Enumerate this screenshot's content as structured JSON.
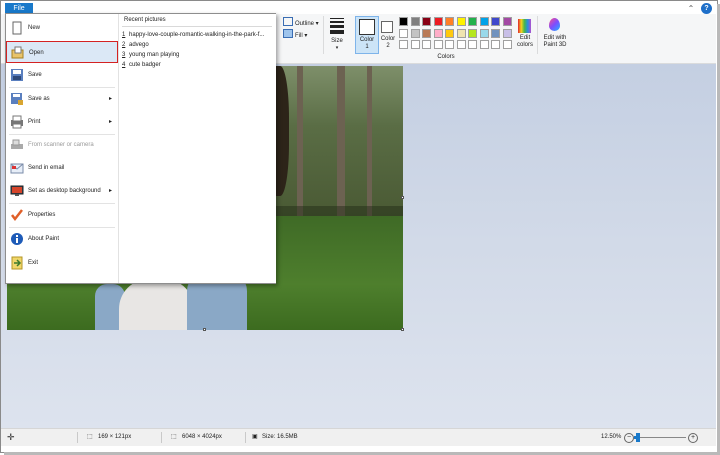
{
  "file_tab": "File",
  "ribbon": {
    "outline_label": "Outline",
    "fill_label": "Fill",
    "size_label": "Size",
    "color1_label": "Color",
    "color1_num": "1",
    "color2_label": "Color",
    "color2_num": "2",
    "colors_group_label": "Colors",
    "edit_colors_l1": "Edit",
    "edit_colors_l2": "colors",
    "paint3d_l1": "Edit with",
    "paint3d_l2": "Paint 3D",
    "palette_row1": [
      "#000000",
      "#7f7f7f",
      "#880015",
      "#ed1c24",
      "#ff7f27",
      "#fff200",
      "#22b14c",
      "#00a2e8",
      "#3f48cc",
      "#a349a4"
    ],
    "palette_row2": [
      "#ffffff",
      "#c3c3c3",
      "#b97a57",
      "#ffaec9",
      "#ffc90e",
      "#efe4b0",
      "#b5e61d",
      "#99d9ea",
      "#7092be",
      "#c8bfe7"
    ]
  },
  "menu": {
    "items": [
      {
        "label": "New",
        "icon": "new-file-icon"
      },
      {
        "label": "Open",
        "icon": "open-folder-icon",
        "selected": true
      },
      {
        "label": "Save",
        "icon": "save-icon"
      },
      {
        "label": "Save as",
        "icon": "save-as-icon",
        "submenu": true
      },
      {
        "label": "Print",
        "icon": "printer-icon",
        "submenu": true
      },
      {
        "label": "From scanner or camera",
        "icon": "scanner-icon",
        "disabled": true
      },
      {
        "label": "Send in email",
        "icon": "email-icon"
      },
      {
        "label": "Set as desktop background",
        "icon": "desktop-icon",
        "submenu": true
      },
      {
        "label": "Properties",
        "icon": "checkmark-icon"
      },
      {
        "label": "About Paint",
        "icon": "info-icon"
      },
      {
        "label": "Exit",
        "icon": "exit-icon"
      }
    ],
    "recent_title": "Recent pictures",
    "recent": [
      {
        "num": "1",
        "name": "happy-love-couple-romantic-walking-in-the-park-f..."
      },
      {
        "num": "2",
        "name": "advego"
      },
      {
        "num": "3",
        "name": "young man playing"
      },
      {
        "num": "4",
        "name": "cute badger"
      }
    ]
  },
  "status": {
    "cursor_pos": "169 × 121px",
    "image_dims": "6048 × 4024px",
    "file_size": "Size: 16.5MB",
    "zoom": "12.50%",
    "zoom_fraction": 0.08
  }
}
